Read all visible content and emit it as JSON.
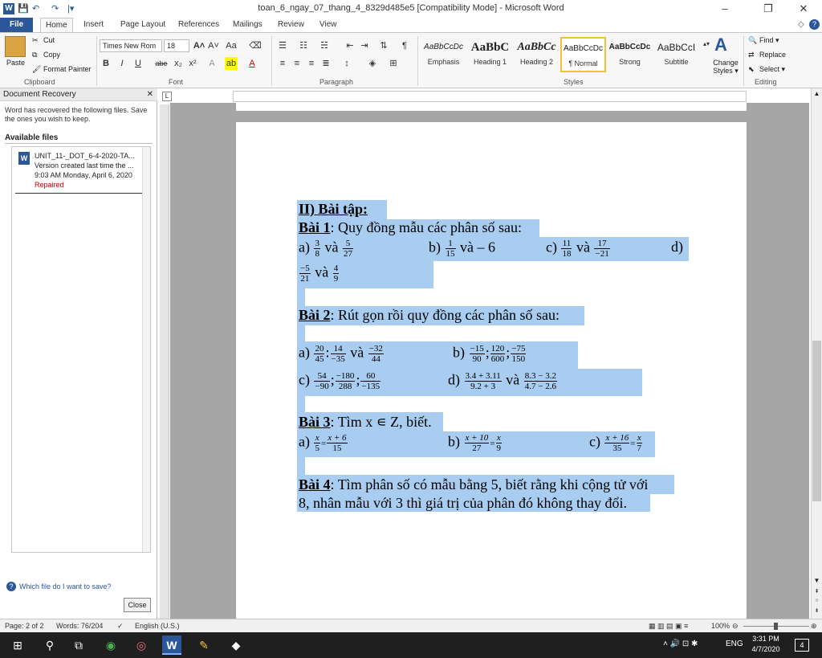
{
  "window": {
    "title": "toan_6_ngay_07_thang_4_8329d485e5 [Compatibility Mode]  -  Microsoft Word",
    "minimize": "–",
    "restore": "❐",
    "close": "✕"
  },
  "quick_access": {
    "undo": "↶",
    "redo": "↷",
    "dropdown": "|▾"
  },
  "tabs": [
    {
      "label": "File"
    },
    {
      "label": "Home"
    },
    {
      "label": "Insert"
    },
    {
      "label": "Page Layout"
    },
    {
      "label": "References"
    },
    {
      "label": "Mailings"
    },
    {
      "label": "Review"
    },
    {
      "label": "View"
    }
  ],
  "ribbon": {
    "clipboard": {
      "paste": "Paste",
      "cut": "Cut",
      "copy": "Copy",
      "format_painter": "Format Painter",
      "label": "Clipboard"
    },
    "font": {
      "name": "Times New Rom",
      "size": "18",
      "label": "Font",
      "bold": "B",
      "italic": "I",
      "underline": "U",
      "strike": "abe",
      "sub": "x₂",
      "sup": "x²"
    },
    "paragraph": {
      "label": "Paragraph",
      "pilcrow": "¶"
    },
    "styles": {
      "label": "Styles",
      "items": [
        {
          "sample": "AaBbCcDc",
          "name": "Emphasis"
        },
        {
          "sample": "AaBbC",
          "name": "Heading 1"
        },
        {
          "sample": "AaBbCc",
          "name": "Heading 2"
        },
        {
          "sample": "AaBbCcDc",
          "name": "¶ Normal"
        },
        {
          "sample": "AaBbCcDc",
          "name": "Strong"
        },
        {
          "sample": "AaBbCcI",
          "name": "Subtitle"
        }
      ],
      "change_styles": "Change Styles ▾"
    },
    "editing": {
      "label": "Editing",
      "find": "Find ▾",
      "replace": "Replace",
      "select": "Select ▾"
    }
  },
  "recovery": {
    "header": "Document Recovery",
    "message": "Word has recovered the following files.  Save the ones you wish to keep.",
    "available": "Available files",
    "file": {
      "name": "UNIT_11-_DOT_6-4-2020-TA...",
      "version": "Version created last time the ...",
      "time": "9:03 AM Monday, April 6, 2020",
      "status": "Repaired"
    },
    "help_link": "Which file do I want to save?",
    "close_button": "Close"
  },
  "document": {
    "heading": "II) Bài tập:",
    "b1_label": "Bài 1",
    "b1_text": ": Quy đồng mẫu các phân số sau:",
    "b1_a": "a)",
    "b1_a_f1n": "3",
    "b1_a_f1d": "8",
    "b1_a_va": "và",
    "b1_a_f2n": "5",
    "b1_a_f2d": "27",
    "b1_b": "b)",
    "b1_b_fn": "1",
    "b1_b_fd": "15",
    "b1_b_rest": "và – 6",
    "b1_c": "c)",
    "b1_c_f1n": "11",
    "b1_c_f1d": "18",
    "b1_c_va": "và",
    "b1_c_f2n": "17",
    "b1_c_f2d": "−21",
    "b1_d": "d)",
    "b1_d_f1n": "−5",
    "b1_d_f1d": "21",
    "b1_d_va": "và",
    "b1_d_f2n": "4",
    "b1_d_f2d": "9",
    "b2_label": "Bài 2",
    "b2_text": ": Rút gọn rồi quy đồng các phân số sau:",
    "b2_a": "a)",
    "b2_a_f1n": "20",
    "b2_a_f1d": "45",
    "b2_a_f2n": "14",
    "b2_a_f2d": "−35",
    "b2_a_va": "và",
    "b2_a_f3n": "−32",
    "b2_a_f3d": "44",
    "b2_b": "b)",
    "b2_b_f1n": "−15",
    "b2_b_f1d": "90",
    "b2_b_f2n": "120",
    "b2_b_f2d": "600",
    "b2_b_f3n": "−75",
    "b2_b_f3d": "150",
    "b2_c": "c)",
    "b2_c_f1n": "54",
    "b2_c_f1d": "−90",
    "b2_c_f2n": "−180",
    "b2_c_f2d": "288",
    "b2_c_f3n": "60",
    "b2_c_f3d": "−135",
    "b2_d": "d)",
    "b2_d_f1n": "3.4 + 3.11",
    "b2_d_f1d": "9.2 + 3",
    "b2_d_va": "và",
    "b2_d_f2n": "8.3 − 3.2",
    "b2_d_f2d": "4.7 − 2.6",
    "b3_label": "Bài 3",
    "b3_text": ": Tìm x ∊ Z, biết.",
    "b3_a": "a)",
    "b3_a_f1n": "x",
    "b3_a_f1d": "5",
    "b3_a_eq": "=",
    "b3_a_f2n": "x + 6",
    "b3_a_f2d": "15",
    "b3_b": "b)",
    "b3_b_f1n": "x + 10",
    "b3_b_f1d": "27",
    "b3_b_eq": "=",
    "b3_b_f2n": "x",
    "b3_b_f2d": "9",
    "b3_c": "c)",
    "b3_c_f1n": "x + 16",
    "b3_c_f1d": "35",
    "b3_c_eq": "=",
    "b3_c_f2n": "x",
    "b3_c_f2d": "7",
    "b4_label": "Bài 4",
    "b4_line1": ": Tìm phân số có mẫu bằng 5, biết rằng khi cộng tử với",
    "b4_line2": "8, nhân mẫu với 3 thì giá trị của phân đó không thay đổi."
  },
  "status": {
    "page": "Page: 2 of 2",
    "words": "Words: 76/204",
    "language": "English (U.S.)",
    "zoom": "100%"
  },
  "taskbar": {
    "time": "3:31 PM",
    "date": "4/7/2020",
    "lang": "ENG",
    "notif": "4"
  },
  "colors": {
    "accent": "#2b579a",
    "highlight": "#a8cdf0",
    "repaired": "#c00000"
  }
}
